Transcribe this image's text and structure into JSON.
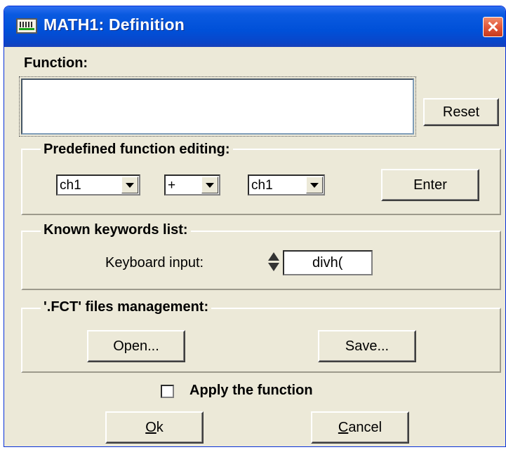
{
  "window": {
    "title": "MATH1: Definition",
    "close_glyph": "✕"
  },
  "function_section": {
    "label": "Function:",
    "value": "",
    "reset_label": "Reset"
  },
  "predefined": {
    "title": "Predefined function editing:",
    "operand1": "ch1",
    "operator": "+",
    "operand2": "ch1",
    "enter_label": "Enter"
  },
  "keywords": {
    "title": "Known keywords list:",
    "input_label": "Keyboard input:",
    "input_value": "divh("
  },
  "files": {
    "title": "'.FCT' files management:",
    "open_label": "Open...",
    "save_label": "Save..."
  },
  "apply": {
    "label": "Apply the function",
    "checked": false
  },
  "footer": {
    "ok_mnemonic": "O",
    "ok_rest": "k",
    "cancel_mnemonic": "C",
    "cancel_rest": "ancel"
  }
}
